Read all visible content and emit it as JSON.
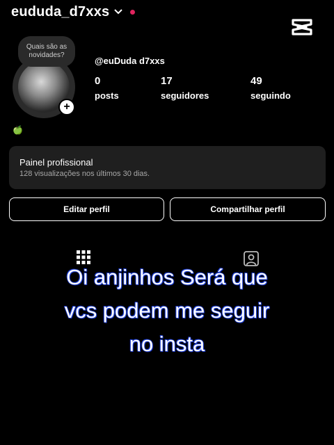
{
  "header": {
    "username": "eududa_d7xxs",
    "icons": {
      "chevron": "chevron-down-icon",
      "notification": "red-dot-indicator",
      "watermark": "capcut-logo"
    }
  },
  "profile": {
    "note": "Quais são as novidades?",
    "display_name": "@euDuda d7xxs",
    "stats": [
      {
        "value": "0",
        "label": "posts"
      },
      {
        "value": "17",
        "label": "seguidores"
      },
      {
        "value": "49",
        "label": "seguindo"
      }
    ],
    "bio_emoji": "🍏"
  },
  "panel": {
    "title": "Painel profissional",
    "subtitle": "128 visualizações nos últimos 30 dias."
  },
  "buttons": {
    "edit": "Editar perfil",
    "share": "Compartilhar perfil"
  },
  "tabs": {
    "icons": [
      "grid-icon",
      "tagged-icon"
    ]
  },
  "caption": {
    "lines": [
      "Oi anjinhos Será que",
      "vcs podem me seguir",
      "no insta"
    ]
  },
  "colors": {
    "background": "#000000",
    "caption_stroke": "#1e3fd6",
    "notification": "#e0245e",
    "panel": "#1f1f1f"
  }
}
